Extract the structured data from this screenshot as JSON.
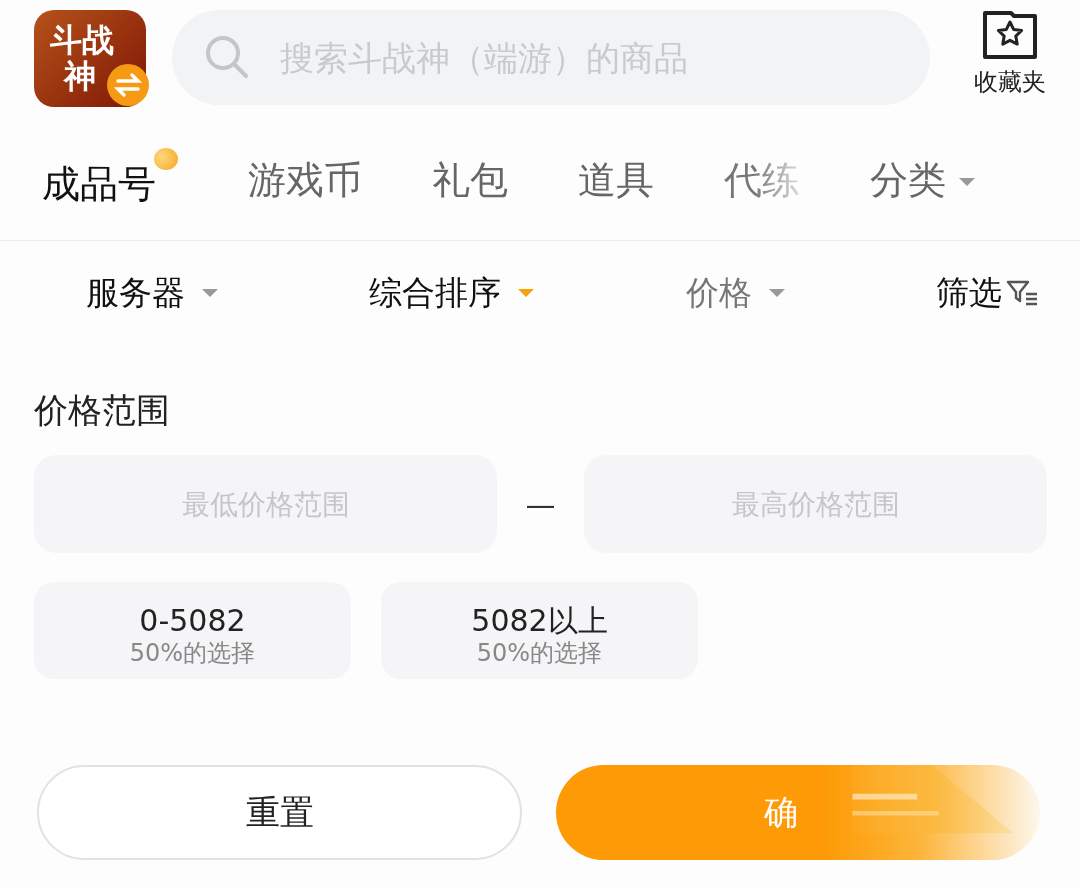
{
  "header": {
    "logo_lines": [
      "斗战",
      "神"
    ],
    "search": {
      "placeholder": "搜索斗战神（端游）的商品"
    },
    "favorites": {
      "label": "收藏夹"
    }
  },
  "tabs": [
    {
      "label": "成品号",
      "selected": true,
      "faded": false,
      "dropdown": false
    },
    {
      "label": "游戏币",
      "selected": false,
      "faded": false,
      "dropdown": false
    },
    {
      "label": "礼包",
      "selected": false,
      "faded": false,
      "dropdown": false
    },
    {
      "label": "道具",
      "selected": false,
      "faded": false,
      "dropdown": false
    },
    {
      "label": "代练",
      "selected": false,
      "faded": true,
      "dropdown": false
    },
    {
      "label": "分类",
      "selected": false,
      "faded": false,
      "dropdown": true
    }
  ],
  "filters": [
    {
      "label": "服务器",
      "kind": "dropdown",
      "selected": false,
      "muted": false
    },
    {
      "label": "综合排序",
      "kind": "dropdown",
      "selected": true,
      "muted": false
    },
    {
      "label": "价格",
      "kind": "dropdown",
      "selected": false,
      "muted": true
    },
    {
      "label": "筛选",
      "kind": "filter",
      "selected": false,
      "muted": false
    }
  ],
  "price_range": {
    "title": "价格范围",
    "min_placeholder": "最低价格范围",
    "separator": "—",
    "max_placeholder": "最高价格范围",
    "presets": [
      {
        "range": "0-5082",
        "share": "50%的选择"
      },
      {
        "range": "5082以上",
        "share": "50%的选择"
      }
    ]
  },
  "buttons": {
    "reset": "重置",
    "confirm": "确"
  }
}
